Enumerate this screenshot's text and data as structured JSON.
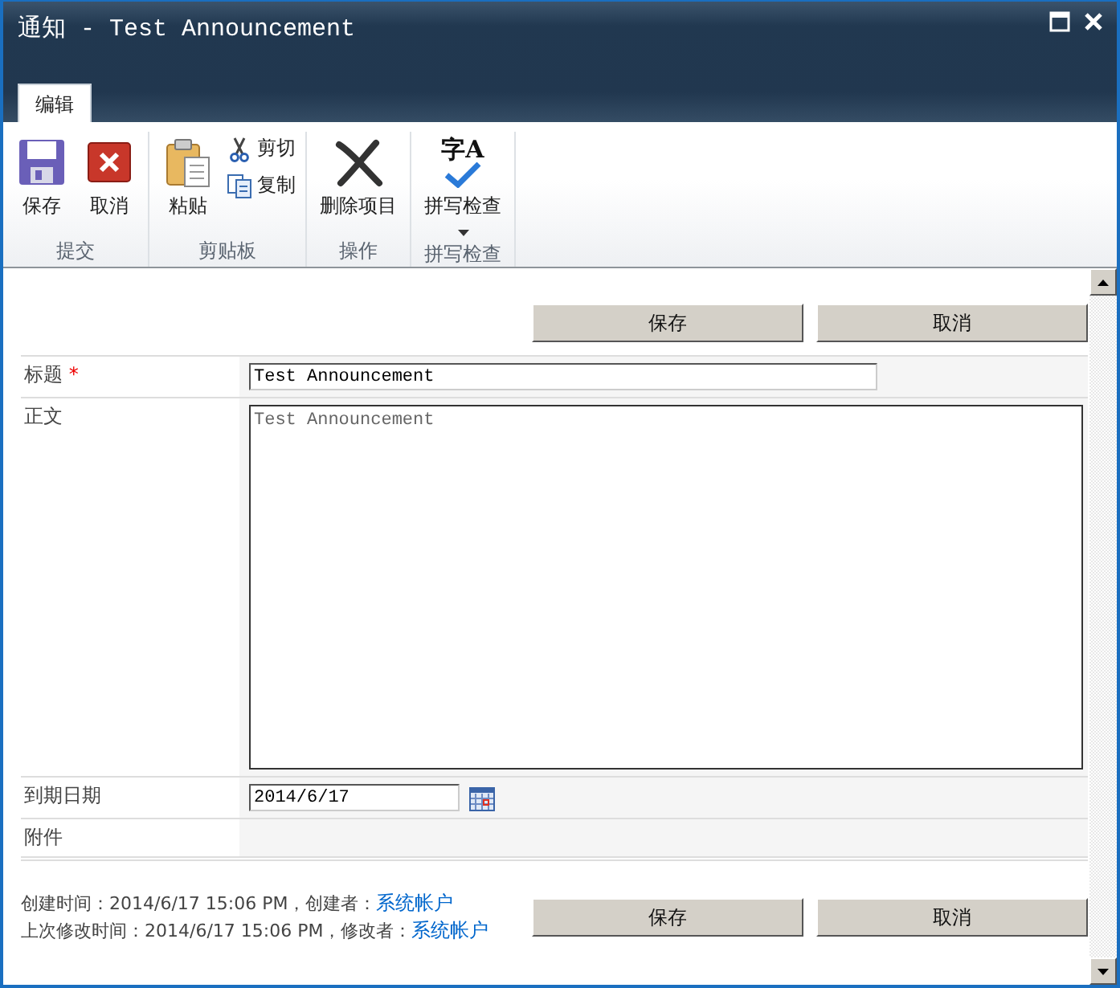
{
  "window": {
    "title": "通知 - Test Announcement"
  },
  "ribbon": {
    "tabs": [
      {
        "label": "编辑",
        "selected": true
      }
    ],
    "groups": [
      {
        "label": "提交",
        "buttons": [
          {
            "label": "保存",
            "kind": "save",
            "dropdown": false
          },
          {
            "label": "取消",
            "kind": "cancel",
            "dropdown": false
          }
        ]
      },
      {
        "label": "剪贴板",
        "buttons": [
          {
            "label": "粘贴",
            "kind": "paste",
            "dropdown": false
          }
        ],
        "small_buttons": [
          {
            "label": "剪切",
            "kind": "cut"
          },
          {
            "label": "复制",
            "kind": "copy"
          }
        ]
      },
      {
        "label": "操作",
        "buttons": [
          {
            "label": "删除项目",
            "kind": "delete",
            "dropdown": false
          }
        ]
      },
      {
        "label": "拼写检查",
        "buttons": [
          {
            "label": "拼写检查",
            "kind": "spelling",
            "dropdown": true,
            "icon_text": "字A"
          }
        ]
      }
    ]
  },
  "top_actions": {
    "buttons": [
      "保存",
      "取消"
    ]
  },
  "fields": [
    {
      "label": "标题",
      "marker": "*",
      "kind": "text",
      "value": "Test Announcement"
    },
    {
      "label": "正文",
      "kind": "textarea",
      "value": "Test Announcement"
    },
    {
      "label": "到期日期",
      "kind": "date",
      "value": "2014/6/17"
    },
    {
      "label": "附件",
      "kind": "attachments"
    }
  ],
  "footer": {
    "lines": [
      {
        "text": "创建时间：2014/6/17 15:06 PM，创建者：",
        "user": "系统帐户"
      },
      {
        "text": "上次修改时间：2014/6/17 15:06 PM，修改者：",
        "user": "系统帐户"
      }
    ],
    "buttons": [
      "保存",
      "取消"
    ]
  }
}
